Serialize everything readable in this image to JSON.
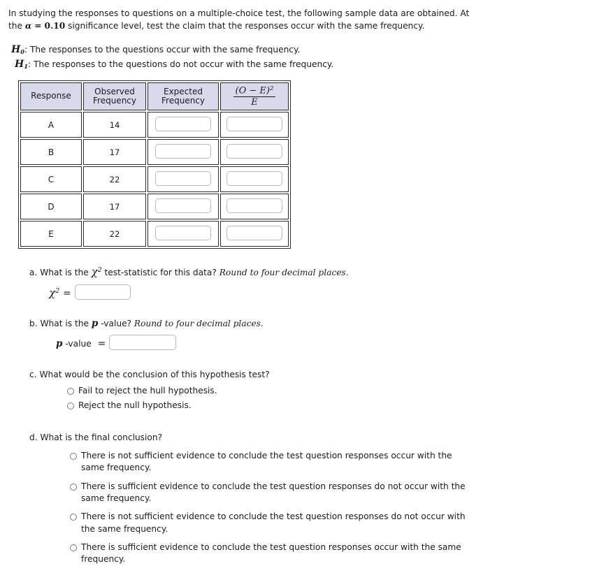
{
  "intro": {
    "part1": "In studying the responses to questions on a multiple-choice test, the following sample data are obtained. At the ",
    "alpha_symbol": "α",
    "equals": "=",
    "alpha_value": "0.10",
    "part2": " significance level, test the claim that the responses occur with the same frequency."
  },
  "hypotheses": {
    "null_symbol": "H",
    "null_subscript": "0",
    "null_text": ": The responses to the questions occur with the same frequency.",
    "alt_symbol": "H",
    "alt_subscript": "1",
    "alt_text": ": The responses to the questions do not occur with the same frequency."
  },
  "table": {
    "headers": {
      "response": "Response",
      "observed_line1": "Observed",
      "observed_line2": "Frequency",
      "expected_line1": "Expected",
      "expected_line2": "Frequency",
      "chi_numerator_left": "(",
      "chi_numerator": "O − E",
      "chi_numerator_right": ")",
      "chi_exponent": "2",
      "chi_denominator": "E"
    },
    "rows": [
      {
        "response": "A",
        "observed": "14",
        "expected": "",
        "chi_term": ""
      },
      {
        "response": "B",
        "observed": "17",
        "expected": "",
        "chi_term": ""
      },
      {
        "response": "C",
        "observed": "22",
        "expected": "",
        "chi_term": ""
      },
      {
        "response": "D",
        "observed": "17",
        "expected": "",
        "chi_term": ""
      },
      {
        "response": "E",
        "observed": "22",
        "expected": "",
        "chi_term": ""
      }
    ]
  },
  "question_a": {
    "label": "a. What is the ",
    "chi_symbol": "χ",
    "chi_exponent": "2",
    "question_rest": " test-statistic for this data? ",
    "note": "Round to four decimal places.",
    "answer_symbol": "χ",
    "answer_exponent": "2",
    "answer_equals": "=",
    "answer_value": ""
  },
  "question_b": {
    "label_part1": "b. What is the ",
    "p_symbol": "p",
    "label_part2": " -value? ",
    "note": "Round to four decimal places.",
    "answer_p": "p",
    "answer_label": " -value ",
    "answer_equals": "=",
    "answer_value": ""
  },
  "question_c": {
    "label": "c. What would be the conclusion of this hypothesis test?",
    "options": [
      "Fail to reject the hull hypothesis.",
      "Reject the null hypothesis."
    ]
  },
  "question_d": {
    "label": "d. What is the final conclusion?",
    "options": [
      "There is not sufficient evidence to conclude the test question responses occur with the same frequency.",
      "There is sufficient evidence to conclude the test question responses do not occur with the same frequency.",
      "There is not sufficient evidence to conclude the test question responses do not occur with the same frequency.",
      "There is sufficient evidence to conclude the test question responses occur with the same frequency."
    ]
  },
  "colors": {
    "header_background": "#d9d9ec",
    "border": "#2b2b2b",
    "input_border": "#b9b9b9",
    "text": "#1b1b1b"
  }
}
